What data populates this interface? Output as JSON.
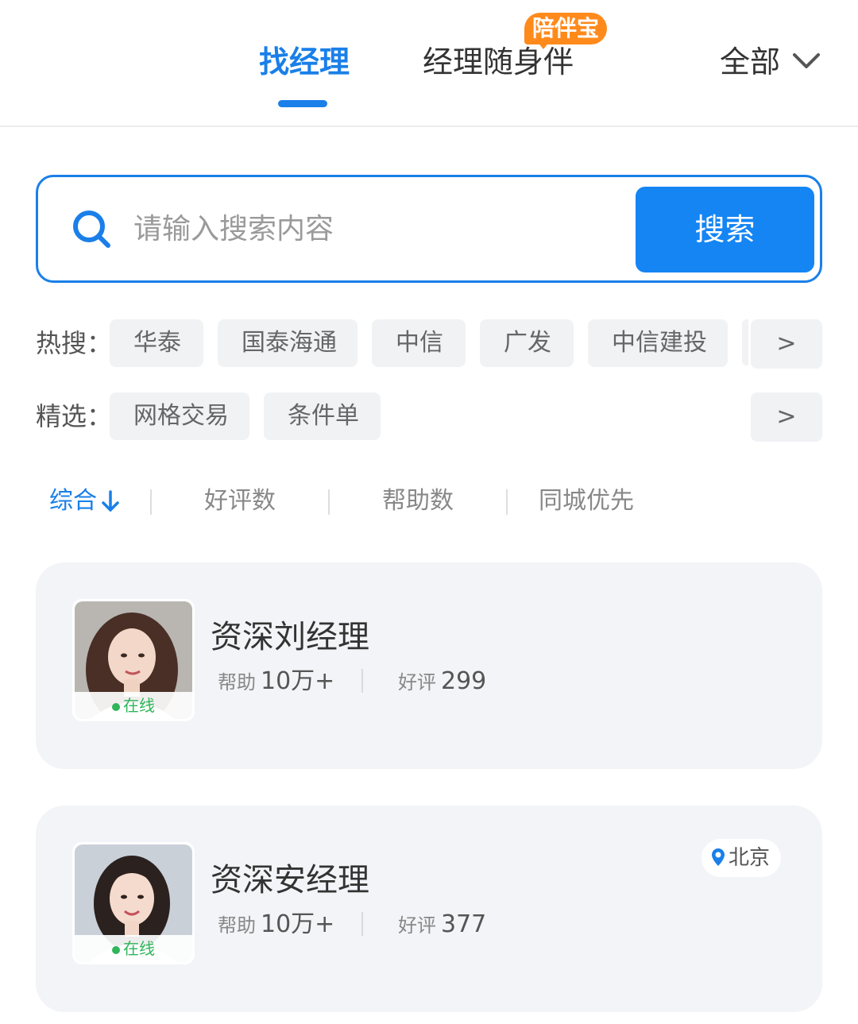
{
  "header": {
    "tab_find": "找经理",
    "tab_companion": "经理随身伴",
    "companion_badge": "陪伴宝",
    "filter_all": "全部"
  },
  "search": {
    "placeholder": "请输入搜索内容",
    "button_label": "搜索"
  },
  "hot_search": {
    "label": "热搜：",
    "items": [
      "华泰",
      "国泰海通",
      "中信",
      "广发",
      "中信建投"
    ],
    "more": ">"
  },
  "featured": {
    "label": "精选：",
    "items": [
      "网格交易",
      "条件单"
    ],
    "more": ">"
  },
  "sort_options": [
    "综合",
    "好评数",
    "帮助数",
    "同城优先"
  ],
  "managers": [
    {
      "name": "资深刘经理",
      "status": "在线",
      "help_label": "帮助",
      "help_value": "10万+",
      "rating_label": "好评",
      "rating_value": "299"
    },
    {
      "name": "资深安经理",
      "status": "在线",
      "help_label": "帮助",
      "help_value": "10万+",
      "rating_label": "好评",
      "rating_value": "377",
      "city": "北京"
    }
  ],
  "colors": {
    "primary": "#1a7fe8",
    "button": "#1585f4",
    "badge": "#ff8a1c",
    "online": "#2fb55a",
    "card_bg": "#f2f4f7",
    "chip_bg": "#f1f2f4"
  },
  "icons": [
    "search-icon",
    "chevron-down-icon",
    "sort-down-arrow-icon",
    "location-pin-icon"
  ]
}
